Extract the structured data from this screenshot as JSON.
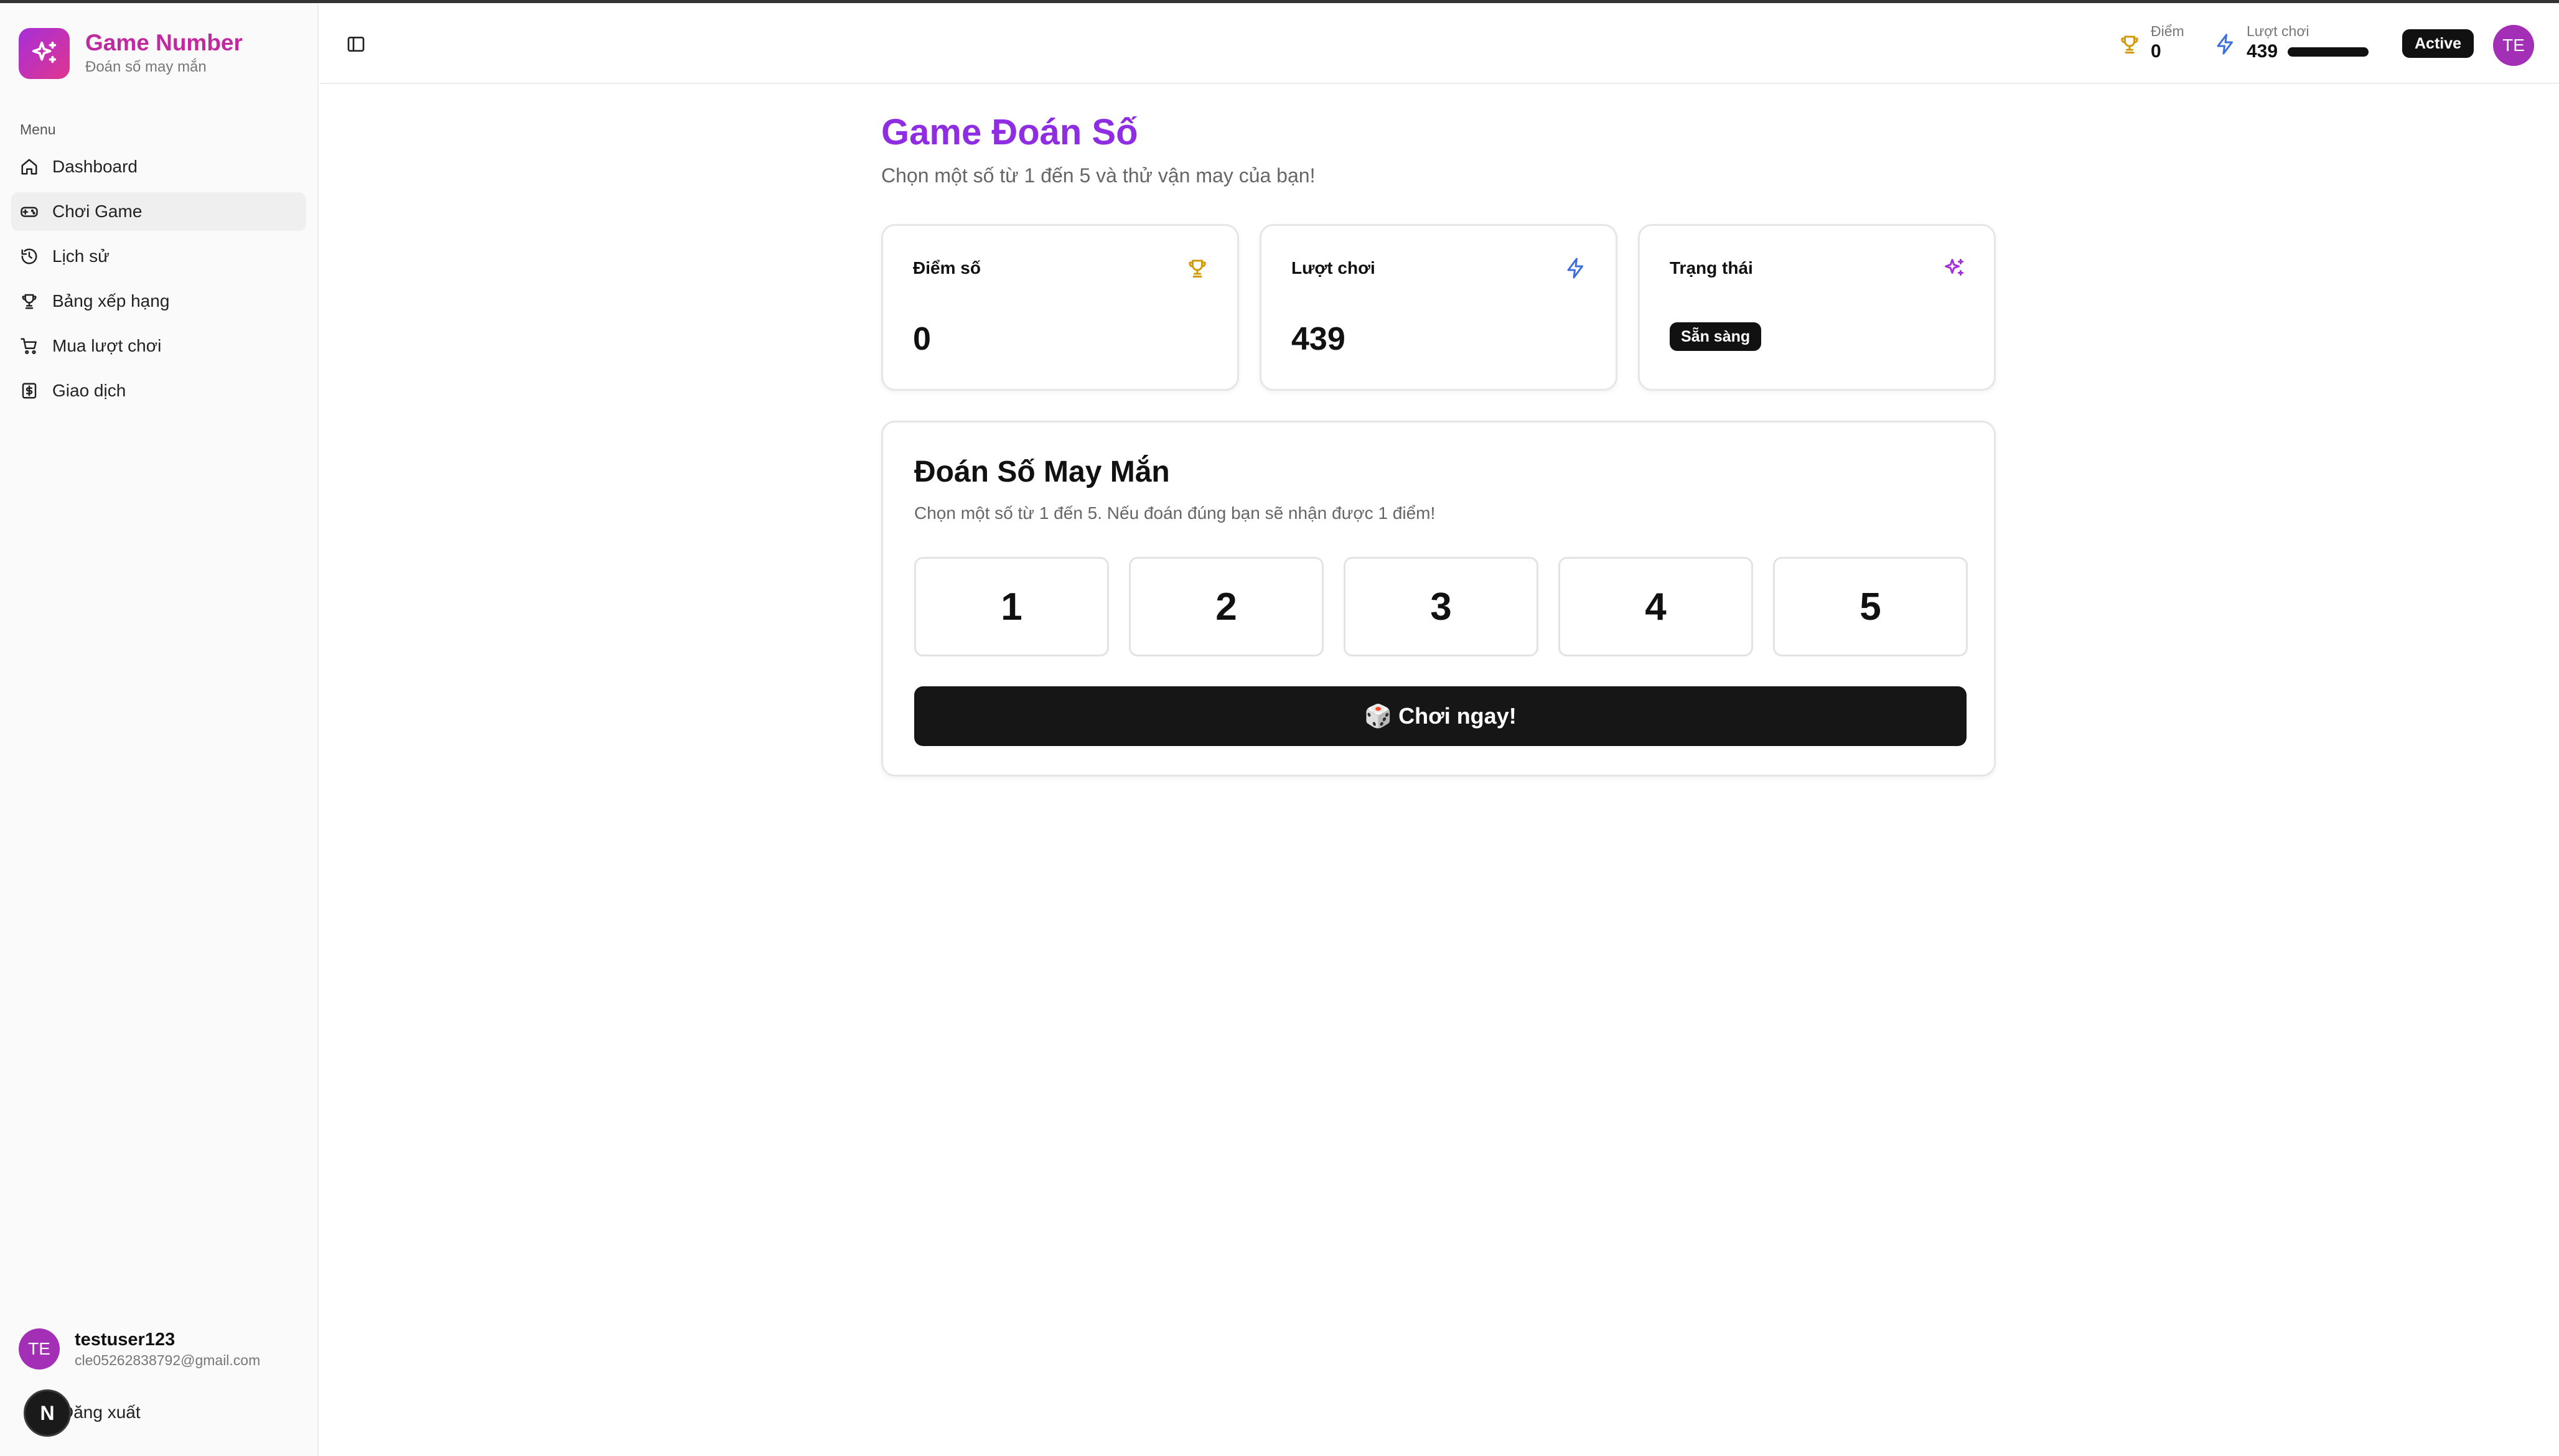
{
  "brand": {
    "name": "Game Number",
    "subtitle": "Đoán số may mắn"
  },
  "sidebar": {
    "menu_label": "Menu",
    "items": [
      {
        "label": "Dashboard",
        "icon": "home-icon"
      },
      {
        "label": "Chơi Game",
        "icon": "gamepad-icon",
        "active": true
      },
      {
        "label": "Lịch sử",
        "icon": "history-icon"
      },
      {
        "label": "Bảng xếp hạng",
        "icon": "trophy-icon"
      },
      {
        "label": "Mua lượt chơi",
        "icon": "cart-icon"
      },
      {
        "label": "Giao dịch",
        "icon": "receipt-icon"
      }
    ],
    "user": {
      "initials": "TE",
      "name": "testuser123",
      "email": "cle05262838792@gmail.com"
    },
    "logout_label": "Đăng xuất",
    "next_badge": "N"
  },
  "header": {
    "score_label": "Điểm",
    "score_value": "0",
    "plays_label": "Lượt chơi",
    "plays_value": "439",
    "plays_bar_fraction": 1.0,
    "status_badge": "Active",
    "avatar_initials": "TE"
  },
  "main": {
    "title": "Game Đoán Số",
    "subtitle": "Chọn một số từ 1 đến 5 và thử vận may của bạn!",
    "cards": {
      "score": {
        "title": "Điểm số",
        "value": "0"
      },
      "plays": {
        "title": "Lượt chơi",
        "value": "439"
      },
      "status": {
        "title": "Trạng thái",
        "badge": "Sẵn sàng"
      }
    },
    "game": {
      "title": "Đoán Số May Mắn",
      "description": "Chọn một số từ 1 đến 5. Nếu đoán đúng bạn sẽ nhận được 1 điểm!",
      "numbers": [
        "1",
        "2",
        "3",
        "4",
        "5"
      ],
      "play_button": "🎲 Chơi ngay!"
    }
  },
  "colors": {
    "brand_gradient_start": "#a62fd8",
    "brand_gradient_end": "#e0358f",
    "title_purple": "#8e2de2",
    "trophy": "#d19a0a",
    "bolt": "#3b6fe0",
    "sparkles": "#a62fd8",
    "avatar": "#a32fb6"
  }
}
